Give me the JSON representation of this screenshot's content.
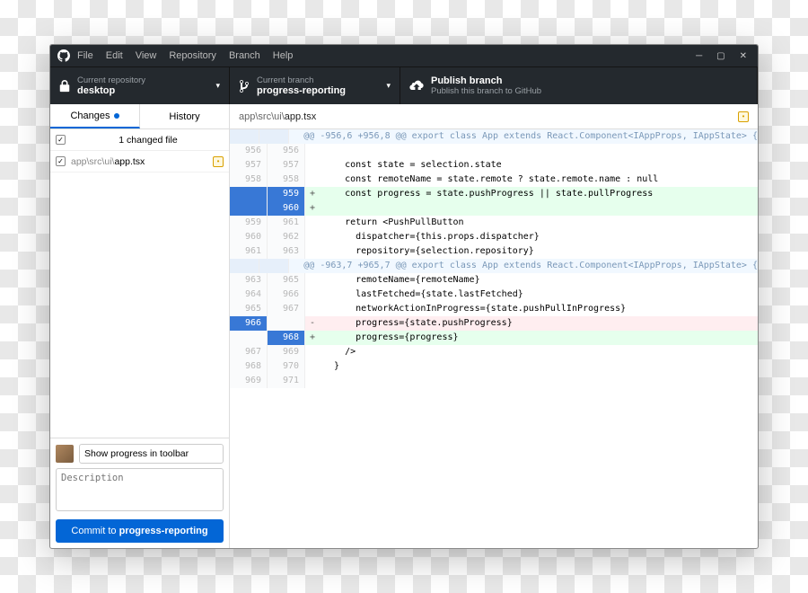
{
  "menubar": [
    "File",
    "Edit",
    "View",
    "Repository",
    "Branch",
    "Help"
  ],
  "toolbar": {
    "repo": {
      "sub": "Current repository",
      "main": "desktop"
    },
    "branch": {
      "sub": "Current branch",
      "main": "progress-reporting"
    },
    "publish": {
      "main": "Publish branch",
      "sub": "Publish this branch to GitHub"
    }
  },
  "tabs": {
    "changes": "Changes",
    "history": "History"
  },
  "changes": {
    "count_label": "1 changed file",
    "file": {
      "dir": "app\\src\\ui\\",
      "name": "app.tsx"
    }
  },
  "commit": {
    "summary": "Show progress in toolbar",
    "desc_placeholder": "Description",
    "button_prefix": "Commit to ",
    "button_branch": "progress-reporting"
  },
  "diff": {
    "path_dir": "app\\src\\ui\\",
    "path_name": "app.tsx",
    "lines": [
      {
        "t": "hunk",
        "a": "",
        "b": "",
        "m": "",
        "c": "@@ -956,6 +956,8 @@ export class App extends React.Component<IAppProps, IAppState> {"
      },
      {
        "t": "ctx",
        "a": "956",
        "b": "956",
        "m": "",
        "c": ""
      },
      {
        "t": "ctx",
        "a": "957",
        "b": "957",
        "m": "",
        "c": "    const state = selection.state"
      },
      {
        "t": "ctx",
        "a": "958",
        "b": "958",
        "m": "",
        "c": "    const remoteName = state.remote ? state.remote.name : null"
      },
      {
        "t": "add",
        "a": "",
        "b": "959",
        "m": "+",
        "c": "    const progress = state.pushProgress || state.pullProgress",
        "asel": true,
        "bsel": true
      },
      {
        "t": "add",
        "a": "",
        "b": "960",
        "m": "+",
        "c": "",
        "asel": true,
        "bsel": true
      },
      {
        "t": "ctx",
        "a": "959",
        "b": "961",
        "m": "",
        "c": "    return <PushPullButton"
      },
      {
        "t": "ctx",
        "a": "960",
        "b": "962",
        "m": "",
        "c": "      dispatcher={this.props.dispatcher}"
      },
      {
        "t": "ctx",
        "a": "961",
        "b": "963",
        "m": "",
        "c": "      repository={selection.repository}"
      },
      {
        "t": "hunk",
        "a": "",
        "b": "",
        "m": "",
        "c": "@@ -963,7 +965,7 @@ export class App extends React.Component<IAppProps, IAppState> {"
      },
      {
        "t": "ctx",
        "a": "963",
        "b": "965",
        "m": "",
        "c": "      remoteName={remoteName}"
      },
      {
        "t": "ctx",
        "a": "964",
        "b": "966",
        "m": "",
        "c": "      lastFetched={state.lastFetched}"
      },
      {
        "t": "ctx",
        "a": "965",
        "b": "967",
        "m": "",
        "c": "      networkActionInProgress={state.pushPullInProgress}"
      },
      {
        "t": "del",
        "a": "966",
        "b": "",
        "m": "-",
        "c": "      progress={state.pushProgress}",
        "asel": true
      },
      {
        "t": "add",
        "a": "",
        "b": "968",
        "m": "+",
        "c": "      progress={progress}",
        "bsel": true
      },
      {
        "t": "ctx",
        "a": "967",
        "b": "969",
        "m": "",
        "c": "    />"
      },
      {
        "t": "ctx",
        "a": "968",
        "b": "970",
        "m": "",
        "c": "  }"
      },
      {
        "t": "ctx",
        "a": "969",
        "b": "971",
        "m": "",
        "c": ""
      }
    ]
  }
}
